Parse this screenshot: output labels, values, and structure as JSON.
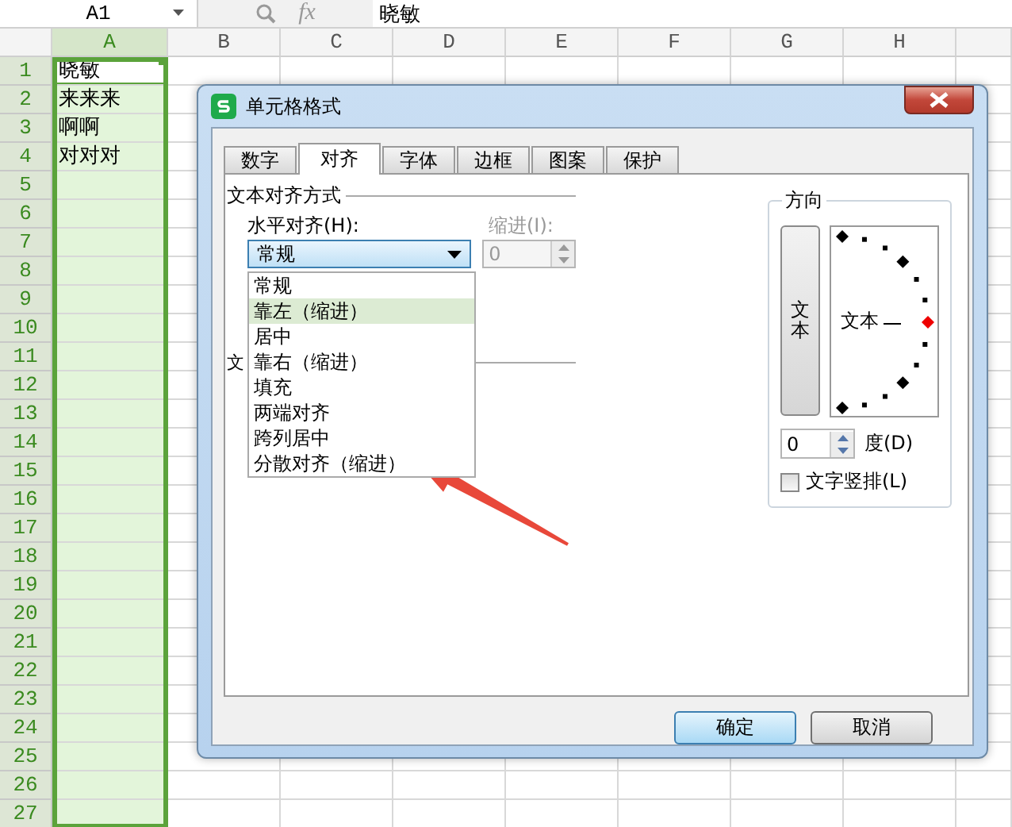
{
  "formula_bar": {
    "cell_ref": "A1",
    "function_label": "fx",
    "value": "晓敏"
  },
  "columns": [
    {
      "label": "A",
      "selected": true
    },
    {
      "label": "B",
      "selected": false
    },
    {
      "label": "C",
      "selected": false
    },
    {
      "label": "D",
      "selected": false
    },
    {
      "label": "E",
      "selected": false
    },
    {
      "label": "F",
      "selected": false
    },
    {
      "label": "G",
      "selected": false
    },
    {
      "label": "H",
      "selected": false
    }
  ],
  "rows": [
    {
      "number": "1",
      "cell_a": "晓敏",
      "active": true
    },
    {
      "number": "2",
      "cell_a": "来来来",
      "active": false
    },
    {
      "number": "3",
      "cell_a": "啊啊",
      "active": false
    },
    {
      "number": "4",
      "cell_a": "对对对",
      "active": false
    },
    {
      "number": "5",
      "active": false
    },
    {
      "number": "6",
      "active": false
    },
    {
      "number": "7",
      "active": false
    },
    {
      "number": "8",
      "active": false
    },
    {
      "number": "9",
      "active": false
    },
    {
      "number": "10",
      "active": false
    },
    {
      "number": "11",
      "active": false
    },
    {
      "number": "12",
      "active": false
    },
    {
      "number": "13",
      "active": false
    },
    {
      "number": "14",
      "active": false
    },
    {
      "number": "15",
      "active": false
    },
    {
      "number": "16",
      "active": false
    },
    {
      "number": "17",
      "active": false
    },
    {
      "number": "18",
      "active": false
    },
    {
      "number": "19",
      "active": false
    },
    {
      "number": "20",
      "active": false
    },
    {
      "number": "21",
      "active": false
    },
    {
      "number": "22",
      "active": false
    },
    {
      "number": "23",
      "active": false
    },
    {
      "number": "24",
      "active": false
    },
    {
      "number": "25",
      "active": false
    },
    {
      "number": "26",
      "active": false
    },
    {
      "number": "27",
      "active": false
    }
  ],
  "dialog": {
    "title": "单元格格式",
    "tabs": [
      {
        "label": "数字",
        "selected": false
      },
      {
        "label": "对齐",
        "selected": true
      },
      {
        "label": "字体",
        "selected": false
      },
      {
        "label": "边框",
        "selected": false
      },
      {
        "label": "图案",
        "selected": false
      },
      {
        "label": "保护",
        "selected": false
      }
    ],
    "text_alignment": {
      "title": "文本对齐方式",
      "horizontal_label": "水平对齐(H):",
      "horizontal_value": "常规",
      "expanded": true,
      "options": [
        {
          "label": "常规",
          "selected": false
        },
        {
          "label": "靠左（缩进）",
          "selected": true
        },
        {
          "label": "居中",
          "selected": false
        },
        {
          "label": "靠右（缩进）",
          "selected": false
        },
        {
          "label": "填充",
          "selected": false
        },
        {
          "label": "两端对齐",
          "selected": false
        },
        {
          "label": "跨列居中",
          "selected": false
        },
        {
          "label": "分散对齐（缩进）",
          "selected": false
        }
      ],
      "indent_label": "缩进(I):",
      "indent_value": "0",
      "indent_disabled": true
    },
    "second_group_title": "文",
    "orientation": {
      "title": "方向",
      "vertical_text": "文本",
      "dial_text": "文本",
      "degrees": "0",
      "degrees_label": "度(D)",
      "vertical_checkbox": {
        "label": "文字竖排(L)",
        "checked": false
      }
    },
    "buttons": [
      {
        "label": "确定",
        "default": true
      },
      {
        "label": "取消",
        "default": false
      }
    ]
  }
}
